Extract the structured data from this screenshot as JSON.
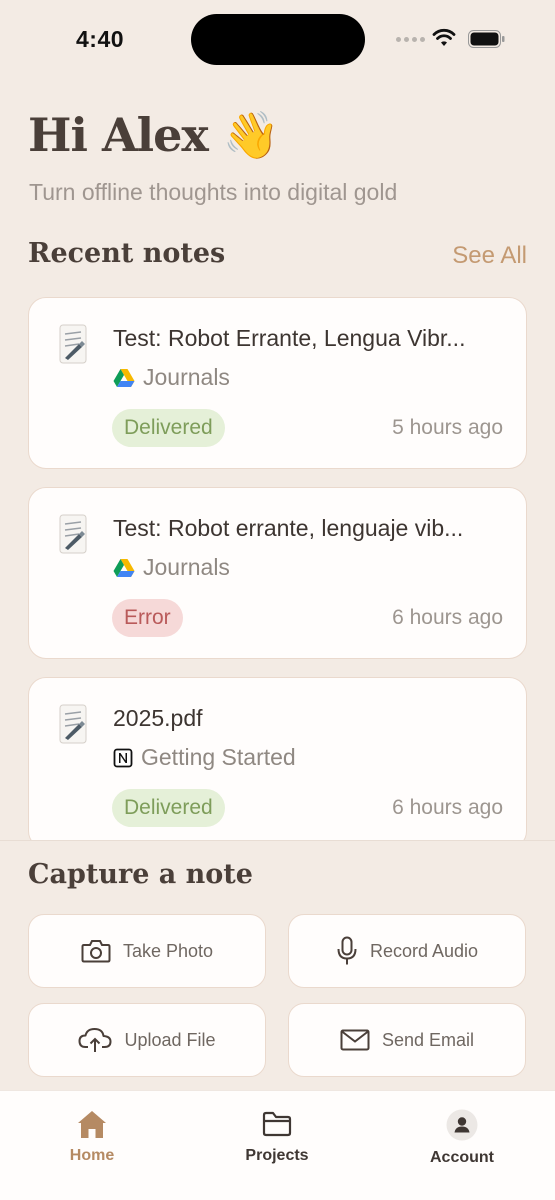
{
  "status_bar": {
    "time": "4:40"
  },
  "header": {
    "greeting": "Hi Alex",
    "wave_emoji": "👋",
    "subtitle": "Turn offline thoughts into digital gold"
  },
  "recent_notes": {
    "title": "Recent notes",
    "see_all_label": "See All",
    "notes": [
      {
        "title": "Test: Robot Errante, Lengua Vibr...",
        "source_icon": "google-drive-icon",
        "source": "Journals",
        "status": "Delivered",
        "time": "5 hours ago"
      },
      {
        "title": "Test: Robot errante, lenguaje vib...",
        "source_icon": "google-drive-icon",
        "source": "Journals",
        "status": "Error",
        "time": "6 hours ago"
      },
      {
        "title": "2025.pdf",
        "source_icon": "notion-icon",
        "source": "Getting Started",
        "status": "Delivered",
        "time": "6 hours ago"
      }
    ]
  },
  "capture": {
    "title": "Capture a note",
    "actions": [
      {
        "label": "Take Photo",
        "icon": "camera-icon"
      },
      {
        "label": "Record Audio",
        "icon": "microphone-icon"
      },
      {
        "label": "Upload File",
        "icon": "cloud-upload-icon"
      },
      {
        "label": "Send Email",
        "icon": "envelope-icon"
      }
    ]
  },
  "tab_bar": {
    "tabs": [
      {
        "label": "Home",
        "icon": "home-icon",
        "active": true
      },
      {
        "label": "Projects",
        "icon": "folder-icon",
        "active": false
      },
      {
        "label": "Account",
        "icon": "account-icon",
        "active": false
      }
    ]
  },
  "colors": {
    "background": "#f3ebe4",
    "accent": "#b58a63",
    "delivered_bg": "#e5f0d8",
    "delivered_text": "#7e9d5a",
    "error_bg": "#f6d9d8",
    "error_text": "#b95a5a"
  }
}
